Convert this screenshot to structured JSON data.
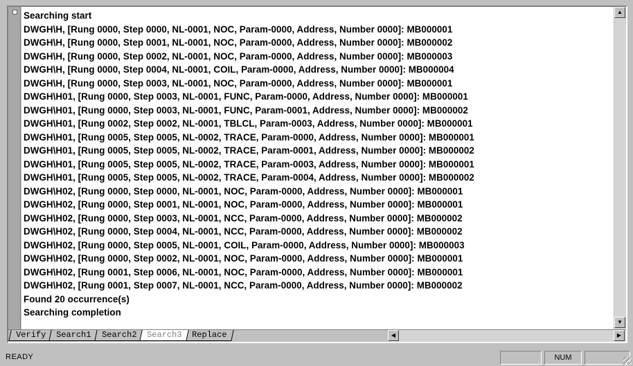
{
  "output_lines": [
    "Searching start",
    "DWGH\\H, [Rung 0000, Step 0000, NL-0001, NOC, Param-0000, Address, Number 0000]: MB000001",
    "DWGH\\H, [Rung 0000, Step 0001, NL-0001, NOC, Param-0000, Address, Number 0000]: MB000002",
    "DWGH\\H, [Rung 0000, Step 0002, NL-0001, NOC, Param-0000, Address, Number 0000]: MB000003",
    "DWGH\\H, [Rung 0000, Step 0004, NL-0001, COIL, Param-0000, Address, Number 0000]: MB000004",
    "DWGH\\H, [Rung 0000, Step 0003, NL-0001, NOC, Param-0000, Address, Number 0000]: MB000001",
    "DWGH\\H01, [Rung 0000, Step 0003, NL-0001, FUNC, Param-0000, Address, Number 0000]: MB000001",
    "DWGH\\H01, [Rung 0000, Step 0003, NL-0001, FUNC, Param-0001, Address, Number 0000]: MB000002",
    "DWGH\\H01, [Rung 0002, Step 0002, NL-0001, TBLCL, Param-0003, Address, Number 0000]: MB000001",
    "DWGH\\H01, [Rung 0005, Step 0005, NL-0002, TRACE, Param-0000, Address, Number 0000]: MB000001",
    "DWGH\\H01, [Rung 0005, Step 0005, NL-0002, TRACE, Param-0001, Address, Number 0000]: MB000002",
    "DWGH\\H01, [Rung 0005, Step 0005, NL-0002, TRACE, Param-0003, Address, Number 0000]: MB000001",
    "DWGH\\H01, [Rung 0005, Step 0005, NL-0002, TRACE, Param-0004, Address, Number 0000]: MB000002",
    "DWGH\\H02, [Rung 0000, Step 0000, NL-0001, NOC, Param-0000, Address, Number 0000]: MB000001",
    "DWGH\\H02, [Rung 0000, Step 0001, NL-0001, NOC, Param-0000, Address, Number 0000]: MB000001",
    "DWGH\\H02, [Rung 0000, Step 0003, NL-0001, NCC, Param-0000, Address, Number 0000]: MB000002",
    "DWGH\\H02, [Rung 0000, Step 0004, NL-0001, NCC, Param-0000, Address, Number 0000]: MB000002",
    "DWGH\\H02, [Rung 0000, Step 0005, NL-0001, COIL, Param-0000, Address, Number 0000]: MB000003",
    "DWGH\\H02, [Rung 0000, Step 0002, NL-0001, NOC, Param-0000, Address, Number 0000]: MB000001",
    "DWGH\\H02, [Rung 0001, Step 0006, NL-0001, NOC, Param-0000, Address, Number 0000]: MB000001",
    "DWGH\\H02, [Rung 0001, Step 0007, NL-0001, NCC, Param-0000, Address, Number 0000]: MB000002",
    "Found 20 occurrence(s)",
    "Searching completion"
  ],
  "tabs": [
    {
      "label": "Verify",
      "active": false
    },
    {
      "label": "Search1",
      "active": false
    },
    {
      "label": "Search2",
      "active": false
    },
    {
      "label": "Search3",
      "active": true
    },
    {
      "label": "Replace",
      "active": false
    }
  ],
  "scroll_icons": {
    "up": "▲",
    "down": "▼",
    "left": "◀",
    "right": "▶"
  },
  "status": {
    "text": "READY",
    "num": "NUM"
  }
}
